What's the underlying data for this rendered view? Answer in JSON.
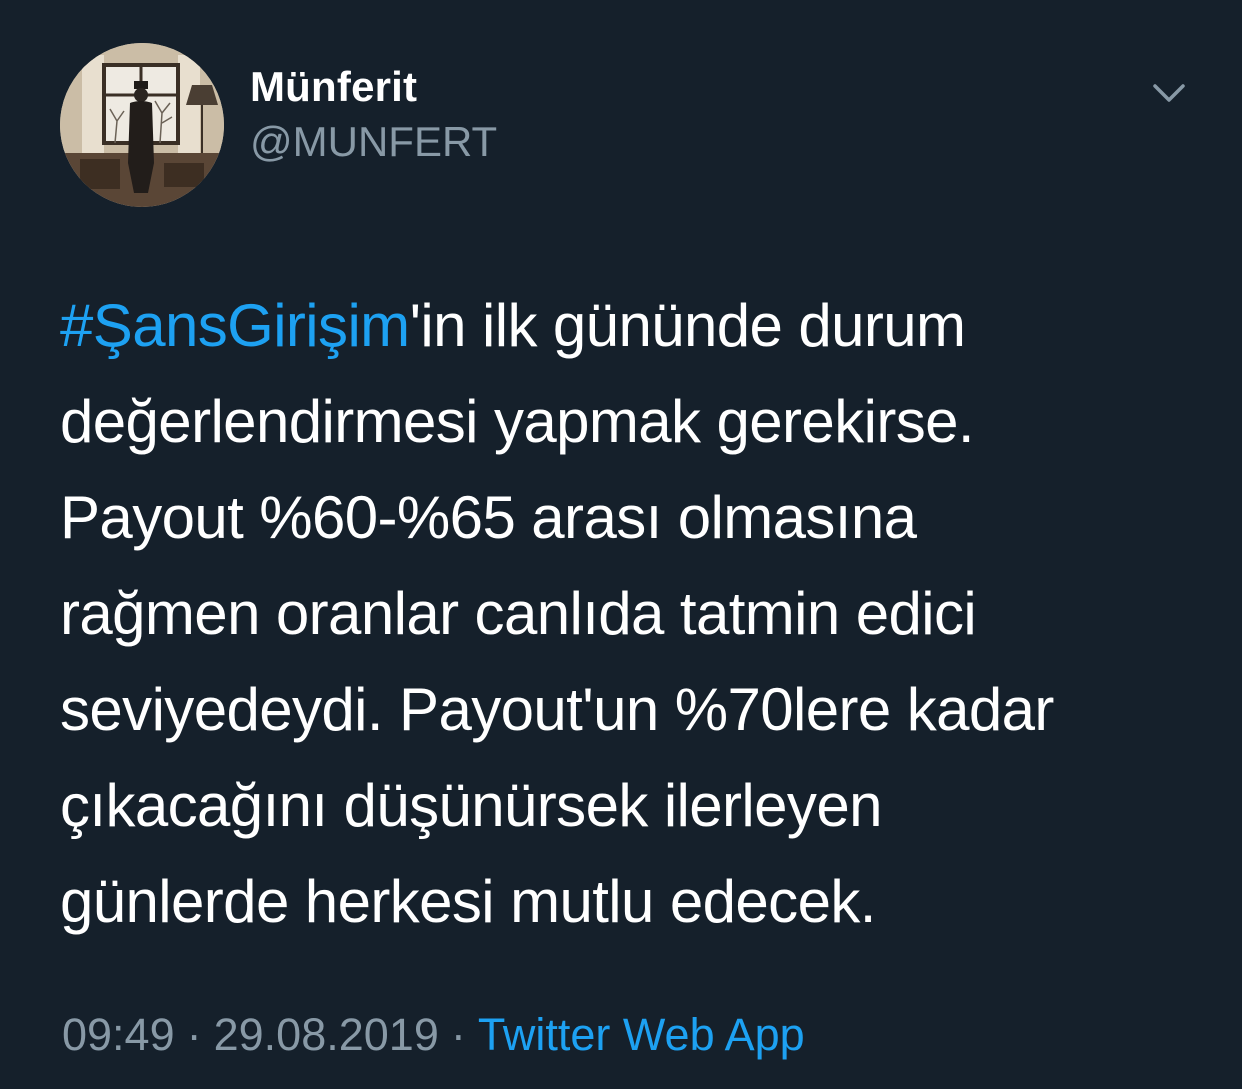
{
  "author": {
    "display_name": "Münferit",
    "handle": "@MUNFERT"
  },
  "tweet": {
    "hashtag": "#ŞansGirişim",
    "text": "'in ilk gününde durum\ndeğerlendirmesi yapmak gerekirse.\nPayout %60-%65 arası olmasına\nrağmen oranlar canlıda tatmin edici\nseviyedeydi. Payout'un %70lere kadar\nçıkacağını düşünürsek ilerleyen\ngünlerde herkesi mutlu edecek."
  },
  "meta": {
    "time": "09:49",
    "separator": "·",
    "date": "29.08.2019",
    "source": "Twitter Web App"
  },
  "icons": {
    "menu": "chevron-down-icon"
  },
  "colors": {
    "background": "#15202b",
    "text": "#ffffff",
    "secondary_text": "#8899a6",
    "link": "#1da1f2"
  }
}
